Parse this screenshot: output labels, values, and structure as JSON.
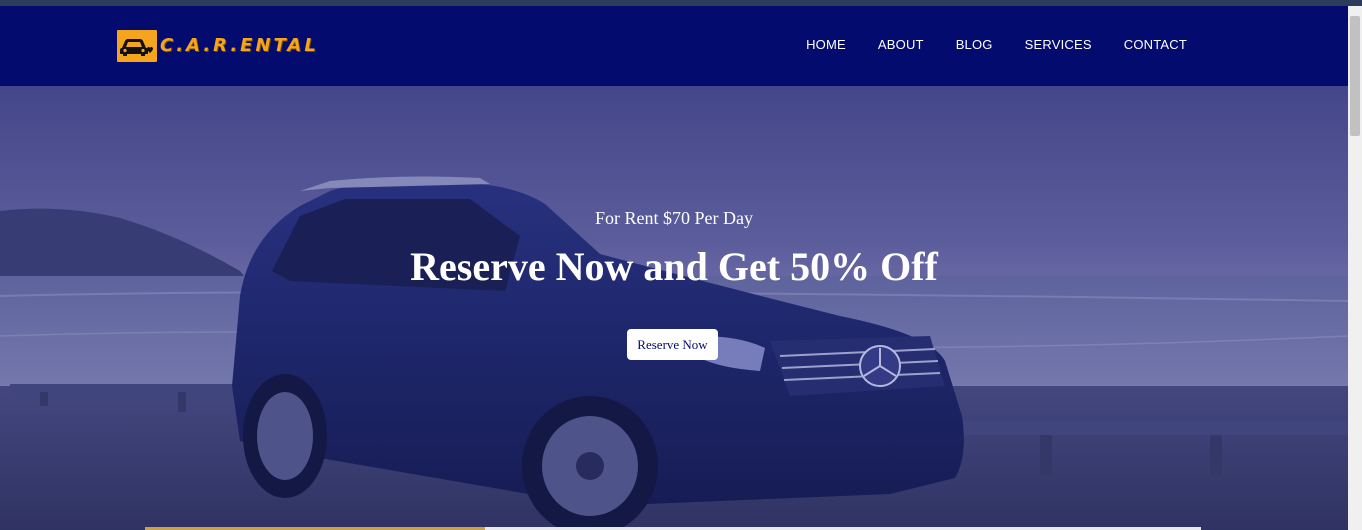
{
  "brand": {
    "name": "C.A.R.ENTAL",
    "accent_color": "#f4a51d",
    "nav_bg_color": "#030c6e",
    "logo_icon": "car-heart-icon"
  },
  "nav": {
    "items": [
      {
        "label": "HOME"
      },
      {
        "label": "ABOUT"
      },
      {
        "label": "BLOG"
      },
      {
        "label": "SERVICES"
      },
      {
        "label": "CONTACT"
      }
    ]
  },
  "hero": {
    "subtitle": "For Rent $70 Per Day",
    "title": "Reserve Now and Get 50% Off",
    "cta_label": "Reserve Now",
    "overlay_color": "#1c1f7a"
  }
}
